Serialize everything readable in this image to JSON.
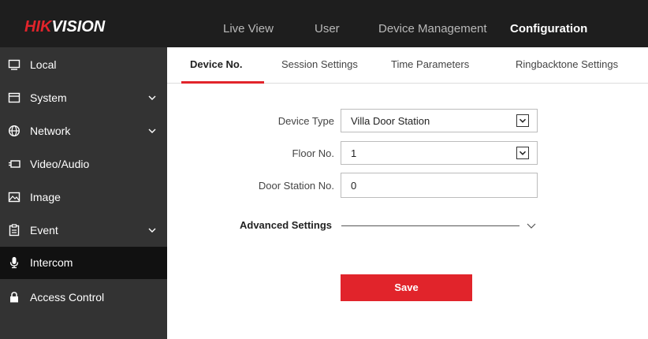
{
  "header": {
    "logo_hik": "HIK",
    "logo_vision": "VISION",
    "nav": [
      {
        "label": "Live View"
      },
      {
        "label": "User"
      },
      {
        "label": "Device Management"
      },
      {
        "label": "Configuration",
        "active": true
      }
    ]
  },
  "sidebar": {
    "items": [
      {
        "label": "Local",
        "icon": "monitor-icon"
      },
      {
        "label": "System",
        "icon": "system-icon",
        "expandable": true
      },
      {
        "label": "Network",
        "icon": "globe-icon",
        "expandable": true
      },
      {
        "label": "Video/Audio",
        "icon": "camera-icon"
      },
      {
        "label": "Image",
        "icon": "image-icon"
      },
      {
        "label": "Event",
        "icon": "clipboard-icon",
        "expandable": true
      },
      {
        "label": "Intercom",
        "icon": "microphone-icon",
        "active": true
      },
      {
        "label": "Access Control",
        "icon": "lock-icon"
      }
    ]
  },
  "tabs": [
    {
      "label": "Device No.",
      "active": true
    },
    {
      "label": "Session Settings"
    },
    {
      "label": "Time Parameters"
    },
    {
      "label": "Ringbacktone Settings"
    }
  ],
  "form": {
    "device_type": {
      "label": "Device Type",
      "value": "Villa Door Station"
    },
    "floor_no": {
      "label": "Floor No.",
      "value": "1"
    },
    "door_station_no": {
      "label": "Door Station No.",
      "value": "0"
    },
    "advanced_label": "Advanced Settings",
    "save_label": "Save"
  },
  "colors": {
    "accent": "#e1242b",
    "topbar": "#1e1e1e",
    "sidebar": "#333333",
    "sidebar_active": "#111111"
  }
}
